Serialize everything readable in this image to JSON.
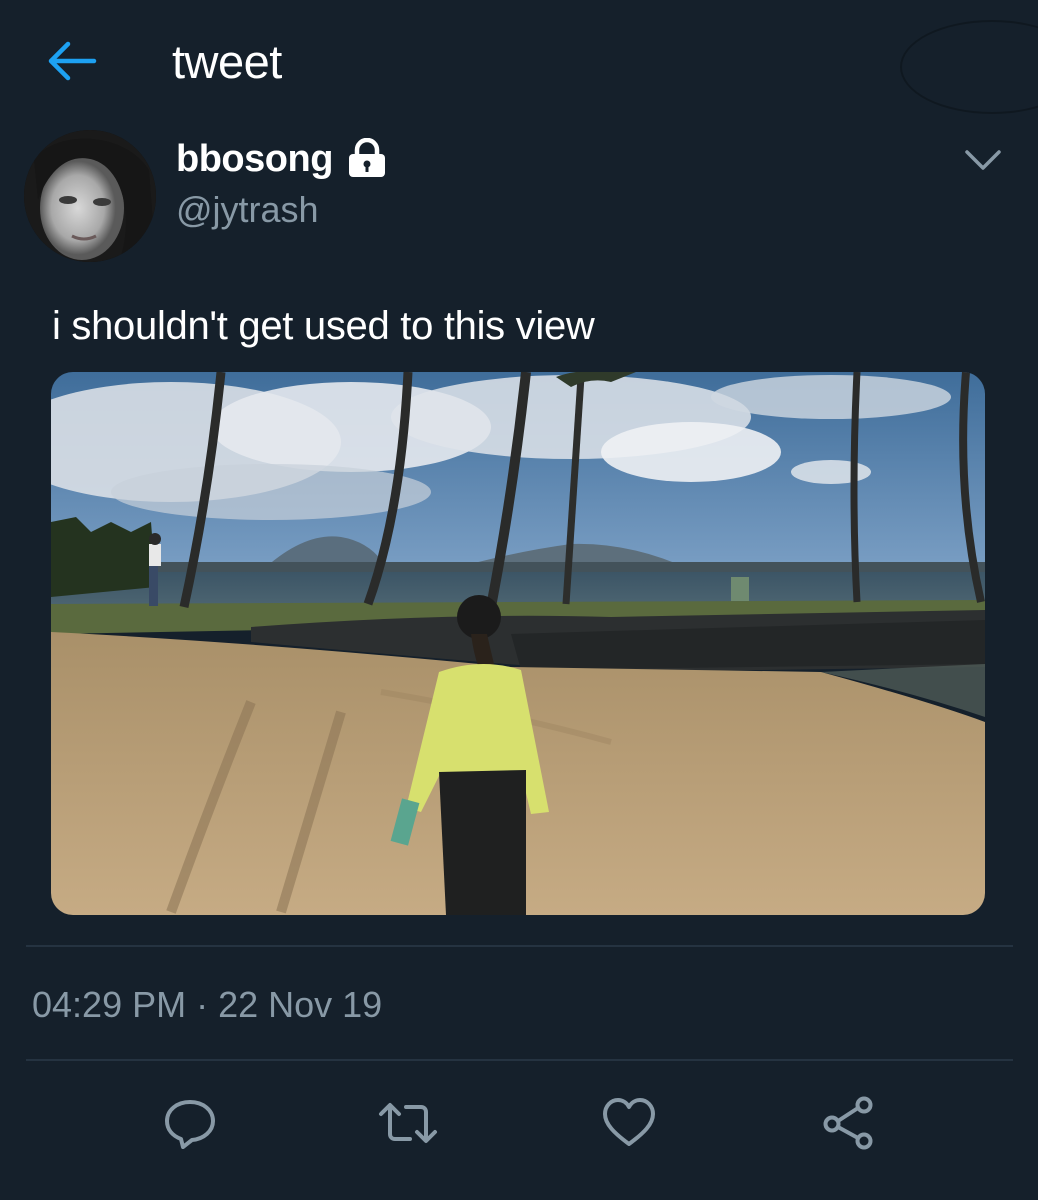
{
  "header": {
    "title": "tweet"
  },
  "tweet": {
    "display_name": "bbosong",
    "handle": "@jytrash",
    "text": "i shouldn't get used to this view",
    "timestamp": "04:29 PM · 22 Nov 19",
    "protected": true
  },
  "colors": {
    "background": "#15202b",
    "accent": "#1da1f2",
    "secondary_text": "#8899a6",
    "divider": "#253341"
  },
  "icons": {
    "back": "arrow-left-icon",
    "lock": "lock-icon",
    "more": "chevron-down-icon",
    "reply": "reply-icon",
    "retweet": "retweet-icon",
    "like": "heart-icon",
    "share": "share-icon"
  }
}
